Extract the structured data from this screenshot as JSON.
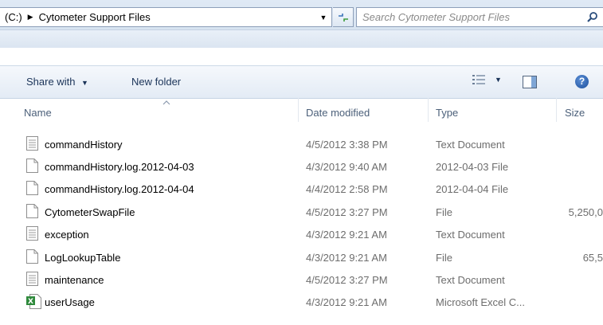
{
  "address": {
    "drive": "(C:)",
    "folder": "Cytometer Support Files"
  },
  "search": {
    "placeholder": "Search Cytometer Support Files"
  },
  "toolbar": {
    "share_with": "Share with",
    "new_folder": "New folder"
  },
  "columns": {
    "name": "Name",
    "date_modified": "Date modified",
    "type": "Type",
    "size": "Size"
  },
  "files": [
    {
      "name": "commandHistory",
      "date": "4/5/2012 3:38 PM",
      "type": "Text Document",
      "size": "",
      "icon": "text-document-icon"
    },
    {
      "name": "commandHistory.log.2012-04-03",
      "date": "4/3/2012 9:40 AM",
      "type": "2012-04-03 File",
      "size": "",
      "icon": "file-icon"
    },
    {
      "name": "commandHistory.log.2012-04-04",
      "date": "4/4/2012 2:58 PM",
      "type": "2012-04-04 File",
      "size": "",
      "icon": "file-icon"
    },
    {
      "name": "CytometerSwapFile",
      "date": "4/5/2012 3:27 PM",
      "type": "File",
      "size": "5,250,0",
      "icon": "file-icon"
    },
    {
      "name": "exception",
      "date": "4/3/2012 9:21 AM",
      "type": "Text Document",
      "size": "",
      "icon": "text-document-icon"
    },
    {
      "name": "LogLookupTable",
      "date": "4/3/2012 9:21 AM",
      "type": "File",
      "size": "65,5",
      "icon": "file-icon"
    },
    {
      "name": "maintenance",
      "date": "4/5/2012 3:27 PM",
      "type": "Text Document",
      "size": "",
      "icon": "text-document-icon"
    },
    {
      "name": "userUsage",
      "date": "4/3/2012 9:21 AM",
      "type": "Microsoft Excel C...",
      "size": "",
      "icon": "excel-icon"
    }
  ],
  "colors": {
    "header_text": "#4c607a",
    "toolbar_text": "#1a3358",
    "secondary_text": "#6d6d6d",
    "chrome_bg": "#dfe9f5"
  }
}
